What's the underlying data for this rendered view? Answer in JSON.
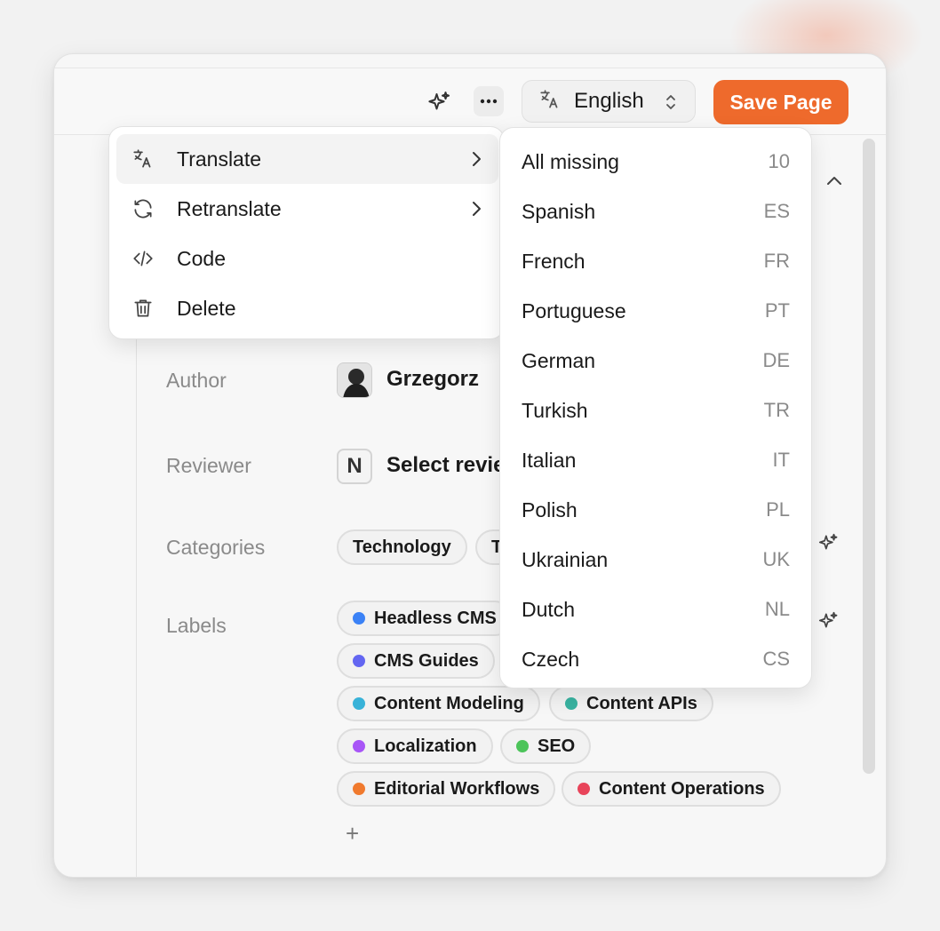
{
  "toolbar": {
    "language_label": "English",
    "save_label": "Save Page"
  },
  "fields": {
    "author": {
      "label": "Author",
      "value": "Grzegorz"
    },
    "reviewer": {
      "label": "Reviewer",
      "badge": "N",
      "value": "Select revie"
    },
    "categories": {
      "label": "Categories",
      "items": [
        "Technology",
        "T"
      ]
    },
    "labels": {
      "label": "Labels",
      "add_label": "+",
      "items": [
        {
          "name": "Headless CMS",
          "color": "#3b82f6"
        },
        {
          "name": "CMS Guides",
          "color": "#6366f1"
        },
        {
          "name": "Content Modeling",
          "color": "#38b2d8"
        },
        {
          "name": "Content APIs",
          "color": "#38b2a0"
        },
        {
          "name": "Localization",
          "color": "#a855f7"
        },
        {
          "name": "SEO",
          "color": "#4cc45a"
        },
        {
          "name": "Editorial Workflows",
          "color": "#f07a2e"
        },
        {
          "name": "Content Operations",
          "color": "#e8445a"
        }
      ]
    }
  },
  "menu": {
    "items": [
      {
        "label": "Translate",
        "icon": "translate-icon"
      },
      {
        "label": "Retranslate",
        "icon": "refresh-icon"
      },
      {
        "label": "Code",
        "icon": "code-icon"
      },
      {
        "label": "Delete",
        "icon": "trash-icon"
      }
    ]
  },
  "submenu": {
    "items": [
      {
        "label": "All missing",
        "code": "10"
      },
      {
        "label": "Spanish",
        "code": "ES"
      },
      {
        "label": "French",
        "code": "FR"
      },
      {
        "label": "Portuguese",
        "code": "PT"
      },
      {
        "label": "German",
        "code": "DE"
      },
      {
        "label": "Turkish",
        "code": "TR"
      },
      {
        "label": "Italian",
        "code": "IT"
      },
      {
        "label": "Polish",
        "code": "PL"
      },
      {
        "label": "Ukrainian",
        "code": "UK"
      },
      {
        "label": "Dutch",
        "code": "NL"
      },
      {
        "label": "Czech",
        "code": "CS"
      }
    ]
  },
  "colors": {
    "accent": "#ee6a2c"
  }
}
